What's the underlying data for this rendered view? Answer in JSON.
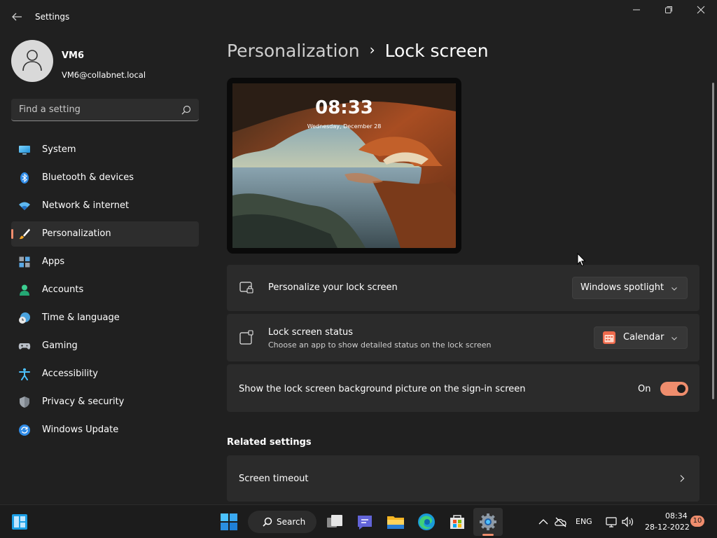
{
  "window": {
    "title": "Settings",
    "controls": [
      "minimize",
      "restore",
      "close"
    ]
  },
  "profile": {
    "name": "VM6",
    "email": "VM6@collabnet.local"
  },
  "search": {
    "placeholder": "Find a setting"
  },
  "nav": {
    "items": [
      {
        "label": "System",
        "icon": "monitor-icon",
        "active": false
      },
      {
        "label": "Bluetooth & devices",
        "icon": "bluetooth-icon",
        "active": false
      },
      {
        "label": "Network & internet",
        "icon": "wifi-icon",
        "active": false
      },
      {
        "label": "Personalization",
        "icon": "brush-icon",
        "active": true
      },
      {
        "label": "Apps",
        "icon": "apps-icon",
        "active": false
      },
      {
        "label": "Accounts",
        "icon": "person-icon",
        "active": false
      },
      {
        "label": "Time & language",
        "icon": "globe-clock-icon",
        "active": false
      },
      {
        "label": "Gaming",
        "icon": "gamepad-icon",
        "active": false
      },
      {
        "label": "Accessibility",
        "icon": "accessibility-icon",
        "active": false
      },
      {
        "label": "Privacy & security",
        "icon": "shield-icon",
        "active": false
      },
      {
        "label": "Windows Update",
        "icon": "update-icon",
        "active": false
      }
    ]
  },
  "breadcrumb": {
    "parent": "Personalization",
    "separator": "›",
    "current": "Lock screen"
  },
  "preview": {
    "time": "08:33",
    "date": "Wednesday, December 28"
  },
  "settings": {
    "personalize": {
      "title": "Personalize your lock screen",
      "value": "Windows spotlight"
    },
    "status": {
      "title": "Lock screen status",
      "subtitle": "Choose an app to show detailed status on the lock screen",
      "value": "Calendar"
    },
    "signin": {
      "title": "Show the lock screen background picture on the sign-in screen",
      "state_label": "On",
      "enabled": true
    }
  },
  "related": {
    "title": "Related settings",
    "items": [
      {
        "label": "Screen timeout"
      }
    ]
  },
  "taskbar": {
    "search_label": "Search",
    "language": "ENG",
    "time": "08:34",
    "date": "28-12-2022",
    "notification_count": "10"
  },
  "colors": {
    "accent": "#ef8d6d",
    "background": "#202020",
    "card": "#2b2b2b",
    "taskbar": "#1c1c1c"
  }
}
